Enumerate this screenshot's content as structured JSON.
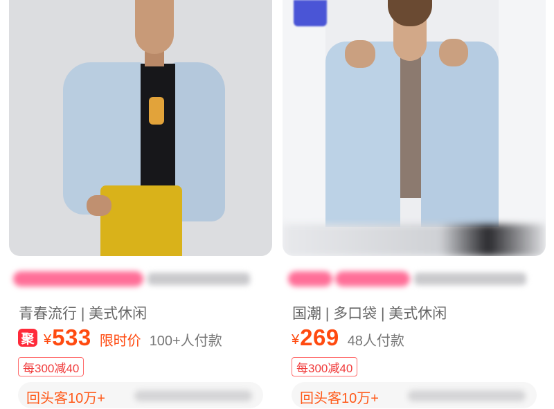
{
  "products": [
    {
      "tags": "青春流行 | 美式休闲",
      "promo_badge": "聚",
      "currency": "¥",
      "price": "533",
      "limited_label": "限时价",
      "buyers": "100+人付款",
      "coupon": "每300减40",
      "repeat_customers": "回头客10万+"
    },
    {
      "tags": "国潮 | 多口袋 | 美式休闲",
      "currency": "¥",
      "price": "269",
      "buyers": "48人付款",
      "coupon": "每300减40",
      "repeat_customers": "回头客10万+"
    }
  ],
  "colors": {
    "price": "#ff4a10",
    "badge": "#ff2a3a",
    "tag_text": "#666666",
    "coupon": "#f03a3a"
  }
}
